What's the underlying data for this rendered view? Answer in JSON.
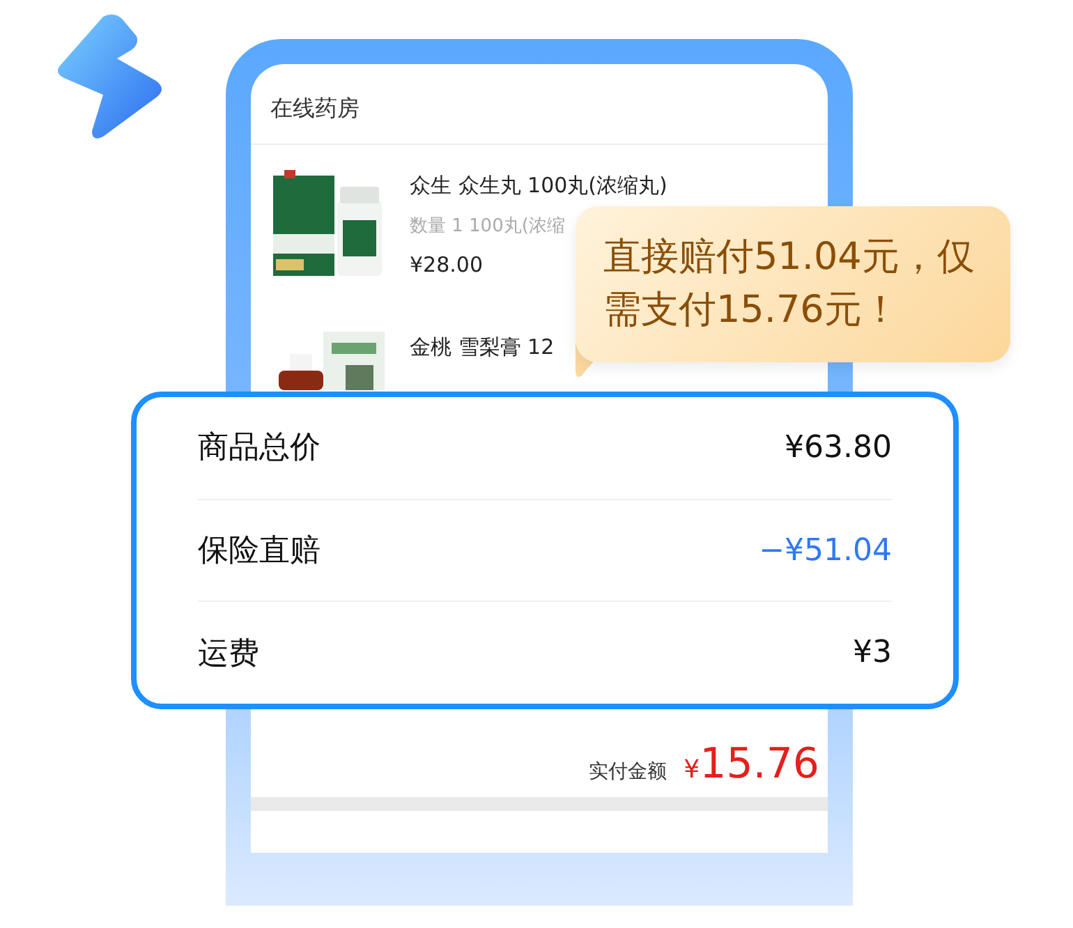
{
  "screen": {
    "title": "在线药房",
    "products": [
      {
        "name": "众生 众生丸 100丸(浓缩丸)",
        "spec": "数量 1  100丸(浓缩",
        "price": "¥28.00"
      },
      {
        "name": "金桃 雪梨膏 12"
      }
    ],
    "total": {
      "label": "实付金额",
      "currency": "¥",
      "amount": "15.76"
    }
  },
  "bubble": {
    "text": "直接赔付51.04元，仅需支付15.76元！"
  },
  "summary": {
    "rows": [
      {
        "label": "商品总价",
        "value": "¥63.80",
        "kind": "normal"
      },
      {
        "label": "保险直赔",
        "value": "−¥51.04",
        "kind": "discount"
      },
      {
        "label": "运费",
        "value": "¥3",
        "kind": "normal"
      }
    ]
  }
}
